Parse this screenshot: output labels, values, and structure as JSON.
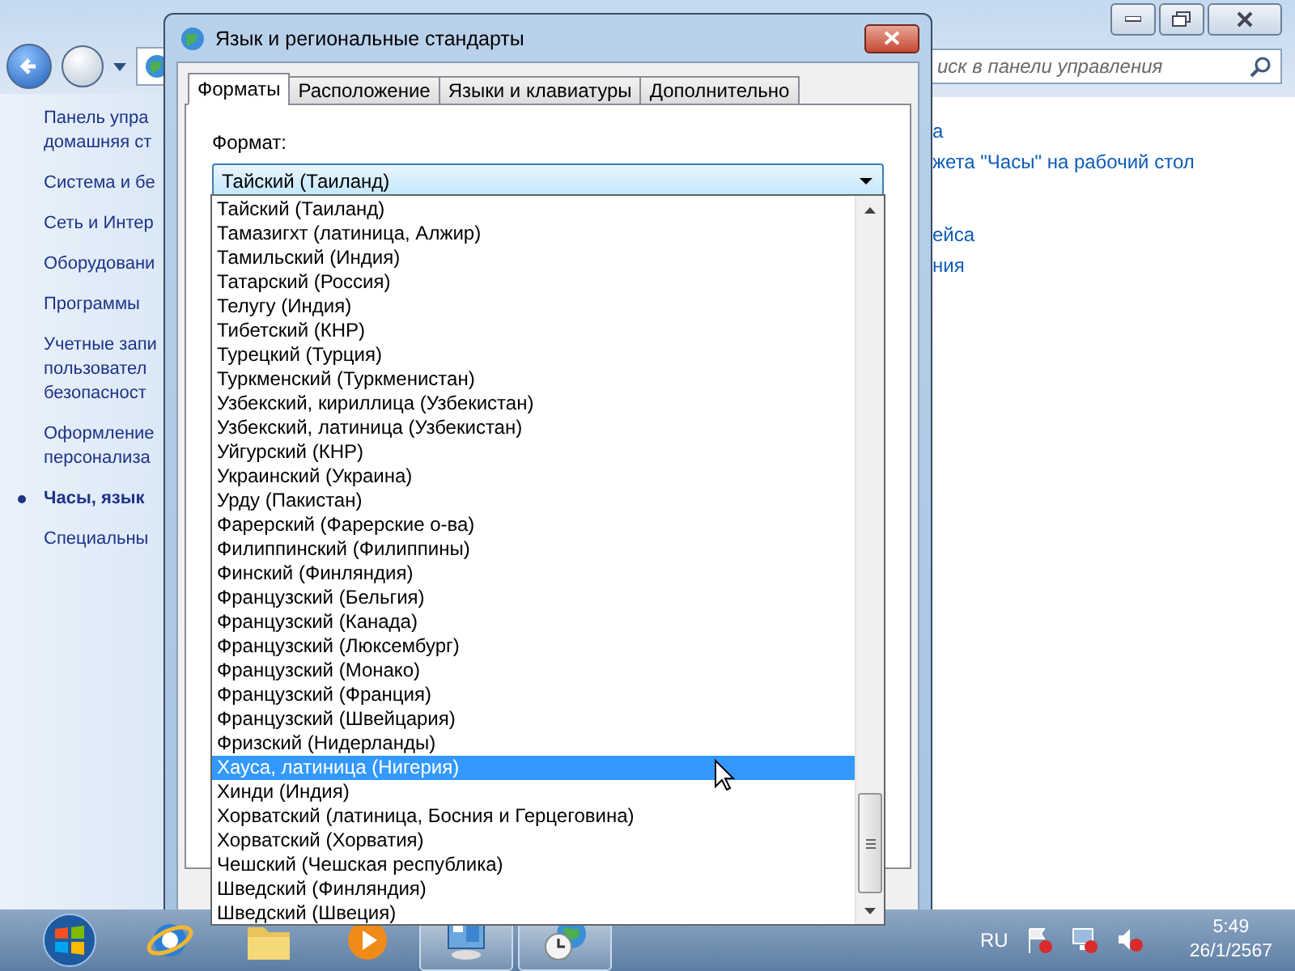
{
  "control_panel": {
    "search": {
      "placeholder": "иск в панели управления"
    },
    "sidebar": {
      "items": [
        {
          "lines": [
            "Панель упра",
            "домашняя ст"
          ],
          "selected": false
        },
        {
          "lines": [
            "Система и бе"
          ],
          "selected": false
        },
        {
          "lines": [
            "Сеть и Интер"
          ],
          "selected": false
        },
        {
          "lines": [
            "Оборудовани"
          ],
          "selected": false
        },
        {
          "lines": [
            "Программы"
          ],
          "selected": false
        },
        {
          "lines": [
            "Учетные запи",
            "пользовател",
            "безопасност"
          ],
          "selected": false
        },
        {
          "lines": [
            "Оформление",
            "персонализа"
          ],
          "selected": false
        },
        {
          "lines": [
            "Часы, язык"
          ],
          "selected": true
        },
        {
          "lines": [
            "Специальны"
          ],
          "selected": false
        }
      ]
    },
    "link_groups": [
      {
        "links": [
          "а",
          "жета \"Часы\" на рабочий стол"
        ]
      },
      {
        "links": [
          "ейса",
          "ния"
        ]
      }
    ]
  },
  "dialog": {
    "title": "Язык и региональные стандарты",
    "tabs": [
      {
        "label": "Форматы",
        "selected": true
      },
      {
        "label": "Расположение",
        "selected": false
      },
      {
        "label": "Языки и клавиатуры",
        "selected": false
      },
      {
        "label": "Дополнительно",
        "selected": false
      }
    ],
    "format_label": "Формат:",
    "format_value": "Тайский (Таиланд)",
    "options": [
      {
        "label": "Тайский (Таиланд)",
        "selected": false
      },
      {
        "label": "Тамазигхт (латиница, Алжир)",
        "selected": false
      },
      {
        "label": "Тамильский (Индия)",
        "selected": false
      },
      {
        "label": "Татарский (Россия)",
        "selected": false
      },
      {
        "label": "Телугу (Индия)",
        "selected": false
      },
      {
        "label": "Тибетский (КНР)",
        "selected": false
      },
      {
        "label": "Турецкий (Турция)",
        "selected": false
      },
      {
        "label": "Туркменский (Туркменистан)",
        "selected": false
      },
      {
        "label": "Узбекский, кириллица (Узбекистан)",
        "selected": false
      },
      {
        "label": "Узбекский, латиница (Узбекистан)",
        "selected": false
      },
      {
        "label": "Уйгурский (КНР)",
        "selected": false
      },
      {
        "label": "Украинский (Украина)",
        "selected": false
      },
      {
        "label": "Урду (Пакистан)",
        "selected": false
      },
      {
        "label": "Фарерский (Фарерские о-ва)",
        "selected": false
      },
      {
        "label": "Филиппинский (Филиппины)",
        "selected": false
      },
      {
        "label": "Финский (Финляндия)",
        "selected": false
      },
      {
        "label": "Французский (Бельгия)",
        "selected": false
      },
      {
        "label": "Французский (Канада)",
        "selected": false
      },
      {
        "label": "Французский (Люксембург)",
        "selected": false
      },
      {
        "label": "Французский (Монако)",
        "selected": false
      },
      {
        "label": "Французский (Франция)",
        "selected": false
      },
      {
        "label": "Французский (Швейцария)",
        "selected": false
      },
      {
        "label": "Фризский (Нидерланды)",
        "selected": false
      },
      {
        "label": "Хауса, латиница (Нигерия)",
        "selected": true
      },
      {
        "label": "Хинди (Индия)",
        "selected": false
      },
      {
        "label": "Хорватский (латиница, Босния и Герцеговина)",
        "selected": false
      },
      {
        "label": "Хорватский (Хорватия)",
        "selected": false
      },
      {
        "label": "Чешский (Чешская республика)",
        "selected": false
      },
      {
        "label": "Шведский (Финляндия)",
        "selected": false
      },
      {
        "label": "Шведский (Швеция)",
        "selected": false
      }
    ]
  },
  "taskbar": {
    "apps": [
      {
        "kind": "browser",
        "active": false
      },
      {
        "kind": "folder",
        "active": false
      },
      {
        "kind": "media",
        "active": false
      },
      {
        "kind": "control",
        "active": true
      },
      {
        "kind": "clock",
        "active": true
      }
    ],
    "language": "RU",
    "time": "5:49",
    "date": "26/1/2567"
  }
}
